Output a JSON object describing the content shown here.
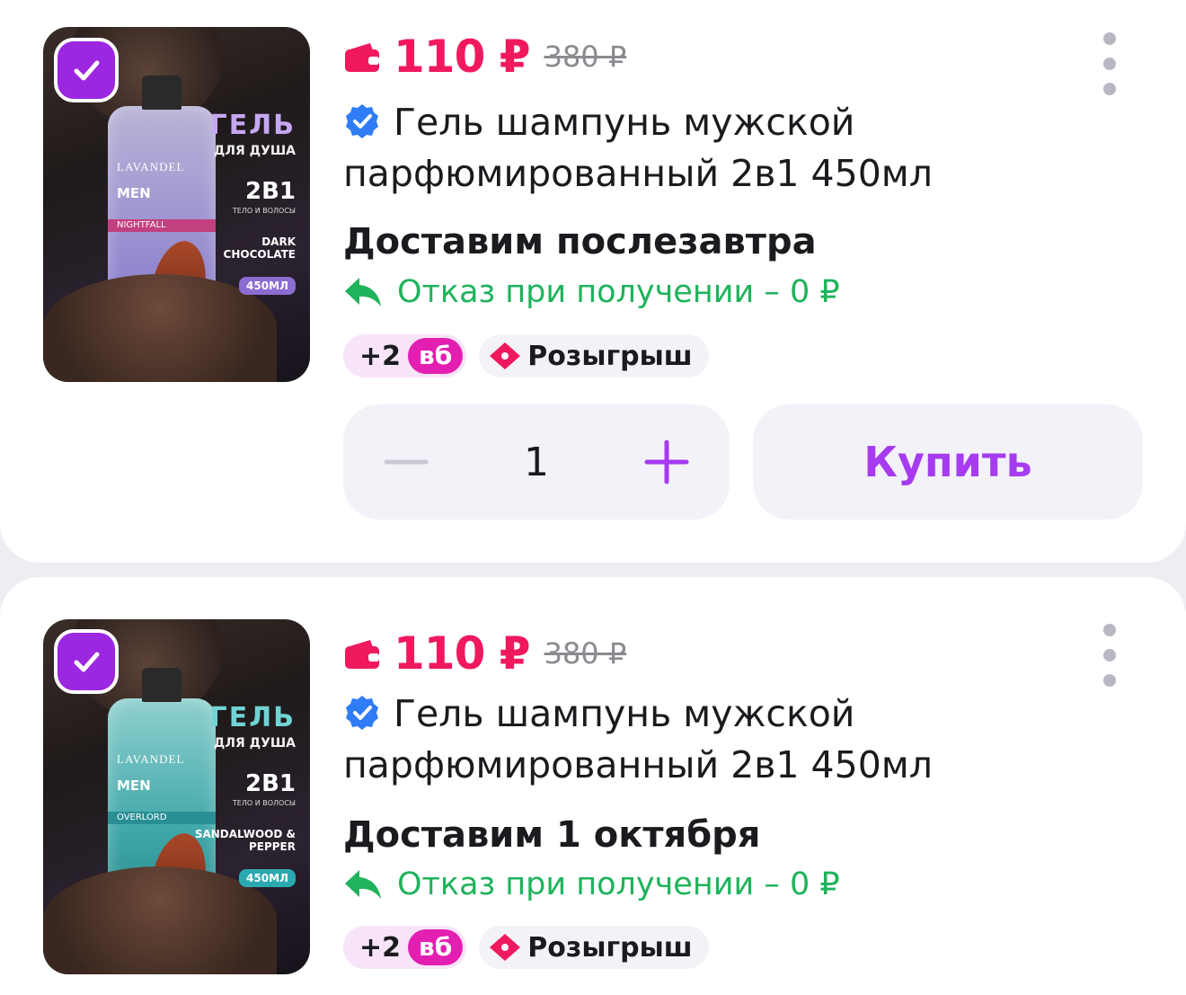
{
  "products": [
    {
      "price": "110 ₽",
      "old_price": "380 ₽",
      "title": "Гель шампунь мужской парфюмированный 2в1 450мл",
      "delivery": "Доставим послезавтра",
      "refund": "Отказ при получении – 0 ₽",
      "bonus": "+2",
      "bonus_badge": "вб",
      "raffle": "Розыгрыш",
      "selected": true,
      "image": {
        "brand": "LAVANDEL",
        "line": "MEN",
        "variant": "NIGHTFALL",
        "headline": "ГЕЛЬ",
        "subline": "ДЛЯ ДУША",
        "format": "2В1",
        "format_note": "ТЕЛО И ВОЛОСЫ",
        "flavor": "DARK CHOCOLATE",
        "volume": "450МЛ"
      },
      "quantity": "1",
      "buy_label": "Купить"
    },
    {
      "price": "110 ₽",
      "old_price": "380 ₽",
      "title": "Гель шампунь мужской парфюмированный 2в1 450мл",
      "delivery": "Доставим 1 октября",
      "refund": "Отказ при получении – 0 ₽",
      "bonus": "+2",
      "bonus_badge": "вб",
      "raffle": "Розыгрыш",
      "selected": true,
      "image": {
        "brand": "LAVANDEL",
        "line": "MEN",
        "variant": "OVERLORD",
        "headline": "ГЕЛЬ",
        "subline": "ДЛЯ ДУША",
        "format": "2В1",
        "format_note": "ТЕЛО И ВОЛОСЫ",
        "flavor": "SANDALWOOD & PEPPER",
        "volume": "450МЛ"
      }
    }
  ],
  "colors": {
    "price": "#f0195e",
    "accent": "#a63bef",
    "checkbox": "#9c27e0",
    "refund": "#1fb35c",
    "verified": "#2f7cf6",
    "badge": "#e21fb1"
  },
  "icons": {
    "wallet": "wallet-icon",
    "verified": "verified-check-icon",
    "refund": "return-arrow-icon",
    "raffle": "ticket-icon",
    "more": "more-vertical-icon",
    "minus": "minus-icon",
    "plus": "plus-icon",
    "checkbox": "checkmark-icon"
  }
}
